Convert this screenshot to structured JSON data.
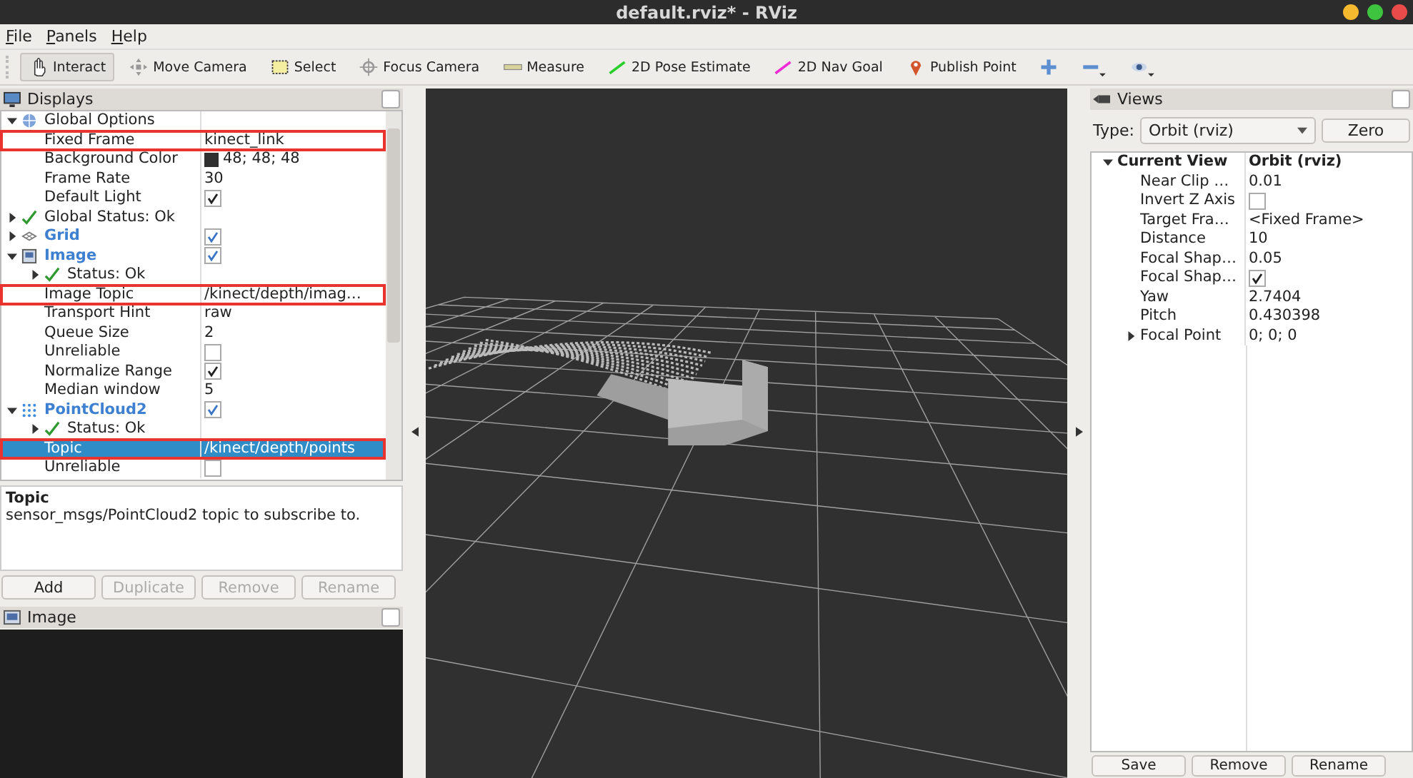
{
  "window": {
    "title": "default.rviz* - RViz"
  },
  "menu": [
    "File",
    "Panels",
    "Help"
  ],
  "toolbar": [
    {
      "kind": "interact",
      "label": "Interact",
      "selected": true
    },
    {
      "kind": "move",
      "label": "Move Camera",
      "selected": false
    },
    {
      "kind": "select",
      "label": "Select",
      "selected": false
    },
    {
      "kind": "focus",
      "label": "Focus Camera",
      "selected": false
    },
    {
      "kind": "measure",
      "label": "Measure",
      "selected": false
    },
    {
      "kind": "pose",
      "label": "2D Pose Estimate",
      "selected": false
    },
    {
      "kind": "nav",
      "label": "2D Nav Goal",
      "selected": false
    },
    {
      "kind": "point",
      "label": "Publish Point",
      "selected": false
    },
    {
      "kind": "add",
      "selected": false
    },
    {
      "kind": "remove",
      "selected": false
    },
    {
      "kind": "eye",
      "selected": false
    }
  ],
  "displays": {
    "title": "Displays",
    "tree": [
      {
        "label": "Global Options",
        "kind": "global",
        "expanded": true,
        "selected": false,
        "highlighted": false,
        "children": [
          {
            "label": "Fixed Frame",
            "kind": "property",
            "value": "kinect_link",
            "selected": false,
            "highlighted": true
          },
          {
            "label": "Background Color",
            "kind": "property",
            "value": "48; 48; 48",
            "color": "#303030",
            "selected": false,
            "highlighted": false
          },
          {
            "label": "Frame Rate",
            "kind": "property",
            "value": "30",
            "selected": false,
            "highlighted": false
          },
          {
            "label": "Default Light",
            "kind": "property",
            "checked": true,
            "selected": false,
            "highlighted": false
          }
        ]
      },
      {
        "label": "Global Status: Ok",
        "kind": "status",
        "expanded": false,
        "selected": false,
        "highlighted": false
      },
      {
        "label": "Grid",
        "kind": "grid",
        "expanded": false,
        "checked": true,
        "selected": false,
        "highlighted": false
      },
      {
        "label": "Image",
        "kind": "image",
        "expanded": true,
        "checked": true,
        "selected": false,
        "highlighted": false,
        "children": [
          {
            "label": "Status: Ok",
            "kind": "status",
            "expanded": false,
            "selected": false,
            "highlighted": false
          },
          {
            "label": "Image Topic",
            "kind": "property",
            "value": "/kinect/depth/imag…",
            "selected": false,
            "highlighted": true
          },
          {
            "label": "Transport Hint",
            "kind": "property",
            "value": "raw",
            "selected": false,
            "highlighted": false
          },
          {
            "label": "Queue Size",
            "kind": "property",
            "value": "2",
            "selected": false,
            "highlighted": false
          },
          {
            "label": "Unreliable",
            "kind": "property",
            "checked": false,
            "selected": false,
            "highlighted": false
          },
          {
            "label": "Normalize Range",
            "kind": "property",
            "checked": true,
            "selected": false,
            "highlighted": false
          },
          {
            "label": "Median window",
            "kind": "property",
            "value": "5",
            "selected": false,
            "highlighted": false
          }
        ]
      },
      {
        "label": "PointCloud2",
        "kind": "pointcloud",
        "expanded": true,
        "checked": true,
        "selected": false,
        "highlighted": false,
        "children": [
          {
            "label": "Status: Ok",
            "kind": "status",
            "expanded": false,
            "selected": false,
            "highlighted": false
          },
          {
            "label": "Topic",
            "kind": "property",
            "value": "/kinect/depth/points",
            "selected": true,
            "highlighted": true
          },
          {
            "label": "Unreliable",
            "kind": "property",
            "checked": false,
            "selected": false,
            "highlighted": false
          }
        ]
      }
    ],
    "description": {
      "title": "Topic",
      "text": "sensor_msgs/PointCloud2 topic to subscribe to."
    },
    "buttons": [
      {
        "label": "Add",
        "disabled": false
      },
      {
        "label": "Duplicate",
        "disabled": true
      },
      {
        "label": "Remove",
        "disabled": true
      },
      {
        "label": "Rename",
        "disabled": true
      }
    ]
  },
  "image_panel": {
    "title": "Image"
  },
  "views": {
    "title": "Views",
    "type_label": "Type:",
    "type": "Orbit (rviz)",
    "zero": "Zero",
    "tree": [
      {
        "label": "Current View",
        "kind": "category",
        "value": "Orbit (rviz)",
        "expanded": true,
        "children": [
          {
            "label": "Near Clip …",
            "kind": "property",
            "value": "0.01"
          },
          {
            "label": "Invert Z Axis",
            "kind": "property",
            "checked": false
          },
          {
            "label": "Target Fra…",
            "kind": "property",
            "value": "<Fixed Frame>"
          },
          {
            "label": "Distance",
            "kind": "property",
            "value": "10"
          },
          {
            "label": "Focal Shap…",
            "kind": "property",
            "value": "0.05"
          },
          {
            "label": "Focal Shap…",
            "kind": "property",
            "checked": true
          },
          {
            "label": "Yaw",
            "kind": "property",
            "value": "2.7404"
          },
          {
            "label": "Pitch",
            "kind": "property",
            "value": "0.430398"
          },
          {
            "label": "Focal Point",
            "kind": "property",
            "value": "0; 0; 0",
            "expanded": false
          }
        ]
      }
    ],
    "buttons": [
      {
        "label": "Save"
      },
      {
        "label": "Remove"
      },
      {
        "label": "Rename"
      }
    ]
  }
}
